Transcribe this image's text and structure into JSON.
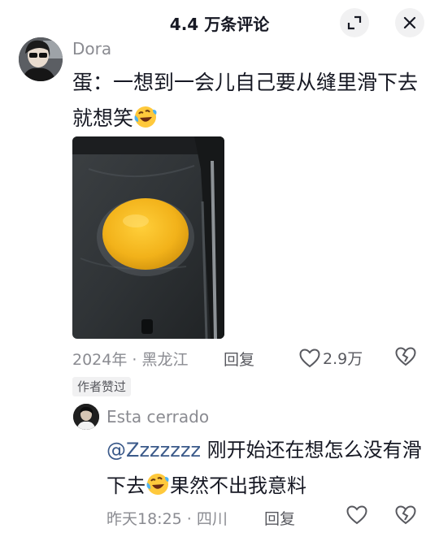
{
  "header": {
    "title": "4.4 万条评论"
  },
  "comment": {
    "username": "Dora",
    "text_part1": "蛋：一想到一会儿自己要从缝里滑下去就想笑",
    "date_location": "2024年 · 黑龙江",
    "reply_label": "回复",
    "like_count": "2.9万",
    "author_badge": "作者赞过"
  },
  "reply": {
    "username": "Esta cerrado",
    "mention": "@Zzzzzzz",
    "text_part1": " 刚开始还在想怎么没有滑下去",
    "text_part2": "果然不出我意料",
    "date_location": "昨天18:25 · 四川",
    "reply_label": "回复"
  }
}
